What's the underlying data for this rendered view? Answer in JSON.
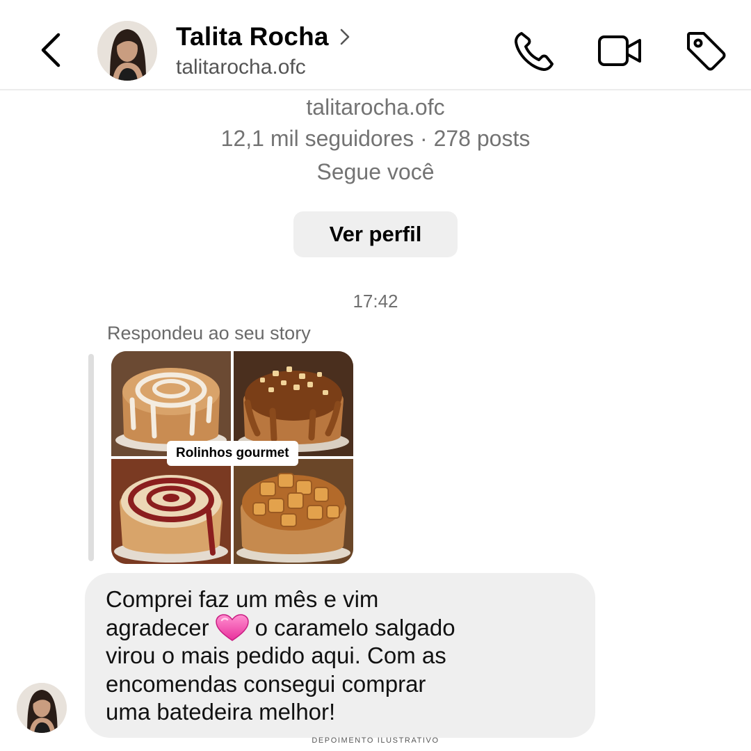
{
  "header": {
    "name": "Talita Rocha",
    "handle": "talitarocha.ofc",
    "back_icon": "chevron-left-icon",
    "call_icon": "phone-icon",
    "video_icon": "video-camera-icon",
    "tag_icon": "tag-icon"
  },
  "profile": {
    "handle": "talitarocha.ofc",
    "stats": "12,1 mil seguidores · 278 posts",
    "follows_you": "Segue você",
    "view_profile_label": "Ver perfil"
  },
  "thread": {
    "timestamp": "17:42",
    "reply_label": "Respondeu ao seu story",
    "story_caption": "Rolinhos gourmet",
    "message_lines": [
      "Comprei faz um mês e vim",
      "agradecer",
      "o caramelo salgado",
      "virou o mais pedido aqui. Com as",
      "encomendas consegui comprar",
      "uma batedeira melhor!"
    ],
    "message_emoji": "pink-heart-icon"
  },
  "footer_note": "DEPOIMENTO ILUSTRATIVO",
  "colors": {
    "bubble": "#efefef",
    "muted_text": "#737373",
    "heart": "#f25ab4"
  }
}
